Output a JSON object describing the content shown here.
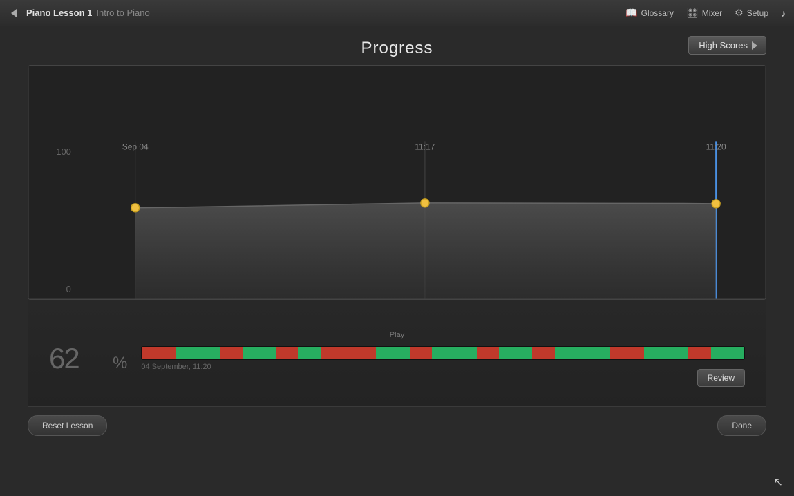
{
  "titlebar": {
    "back_icon": "◀",
    "lesson_title": "Piano Lesson 1",
    "lesson_subtitle": "Intro to Piano",
    "nav": [
      {
        "label": "Glossary",
        "icon": "📖",
        "name": "glossary"
      },
      {
        "label": "Mixer",
        "icon": "🎛",
        "name": "mixer"
      },
      {
        "label": "Setup",
        "icon": "⚙",
        "name": "setup"
      },
      {
        "label": "",
        "icon": "♪",
        "name": "music"
      }
    ]
  },
  "page": {
    "title": "Progress",
    "high_scores_label": "High Scores"
  },
  "chart": {
    "y_max": "100",
    "y_min": "0",
    "markers": [
      {
        "label": "Sep 04",
        "x_pct": 15
      },
      {
        "label": "11:17",
        "x_pct": 57
      },
      {
        "label": "11:20",
        "x_pct": 97
      }
    ],
    "data_points": [
      {
        "x_pct": 15,
        "y_pct": 42
      },
      {
        "x_pct": 57,
        "y_pct": 40
      },
      {
        "x_pct": 97,
        "y_pct": 41
      }
    ]
  },
  "bottom": {
    "play_label": "Play",
    "score": "62",
    "percent_sign": "%",
    "timestamp": "04 September, 11:20",
    "review_label": "Review",
    "segments": [
      {
        "color": "#c0392b",
        "flex": 3
      },
      {
        "color": "#27ae60",
        "flex": 4
      },
      {
        "color": "#c0392b",
        "flex": 2
      },
      {
        "color": "#27ae60",
        "flex": 3
      },
      {
        "color": "#c0392b",
        "flex": 2
      },
      {
        "color": "#27ae60",
        "flex": 2
      },
      {
        "color": "#c0392b",
        "flex": 5
      },
      {
        "color": "#27ae60",
        "flex": 3
      },
      {
        "color": "#c0392b",
        "flex": 2
      },
      {
        "color": "#27ae60",
        "flex": 4
      },
      {
        "color": "#c0392b",
        "flex": 2
      },
      {
        "color": "#27ae60",
        "flex": 3
      },
      {
        "color": "#c0392b",
        "flex": 2
      },
      {
        "color": "#27ae60",
        "flex": 5
      },
      {
        "color": "#c0392b",
        "flex": 3
      },
      {
        "color": "#27ae60",
        "flex": 4
      },
      {
        "color": "#c0392b",
        "flex": 2
      },
      {
        "color": "#27ae60",
        "flex": 3
      }
    ]
  },
  "footer": {
    "reset_label": "Reset Lesson",
    "done_label": "Done"
  }
}
